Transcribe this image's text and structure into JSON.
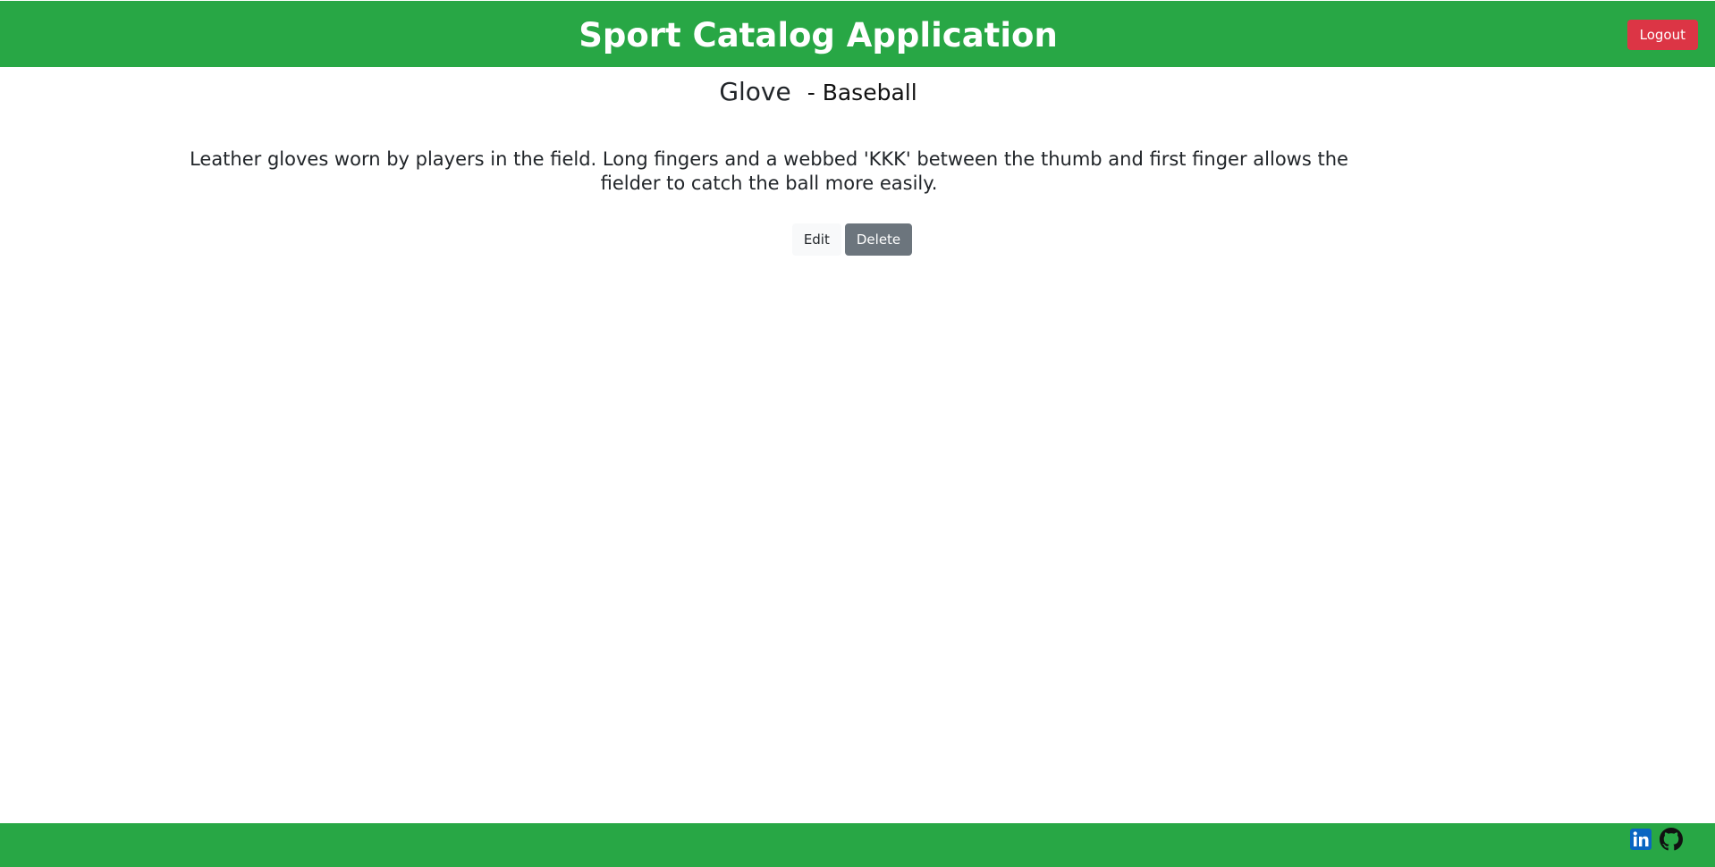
{
  "header": {
    "title": "Sport Catalog Application",
    "logout_label": "Logout",
    "background_color": "#28a745",
    "logout_color": "#dc3545"
  },
  "item": {
    "name": "Glove",
    "category": "- Baseball",
    "description": "Leather gloves worn by players in the field. Long fingers and a webbed 'KKK' between the thumb and first finger allows the fielder to catch the ball more easily."
  },
  "actions": {
    "edit_label": "Edit",
    "delete_label": "Delete"
  },
  "footer": {
    "icons": [
      "linkedin-icon",
      "github-icon"
    ]
  }
}
